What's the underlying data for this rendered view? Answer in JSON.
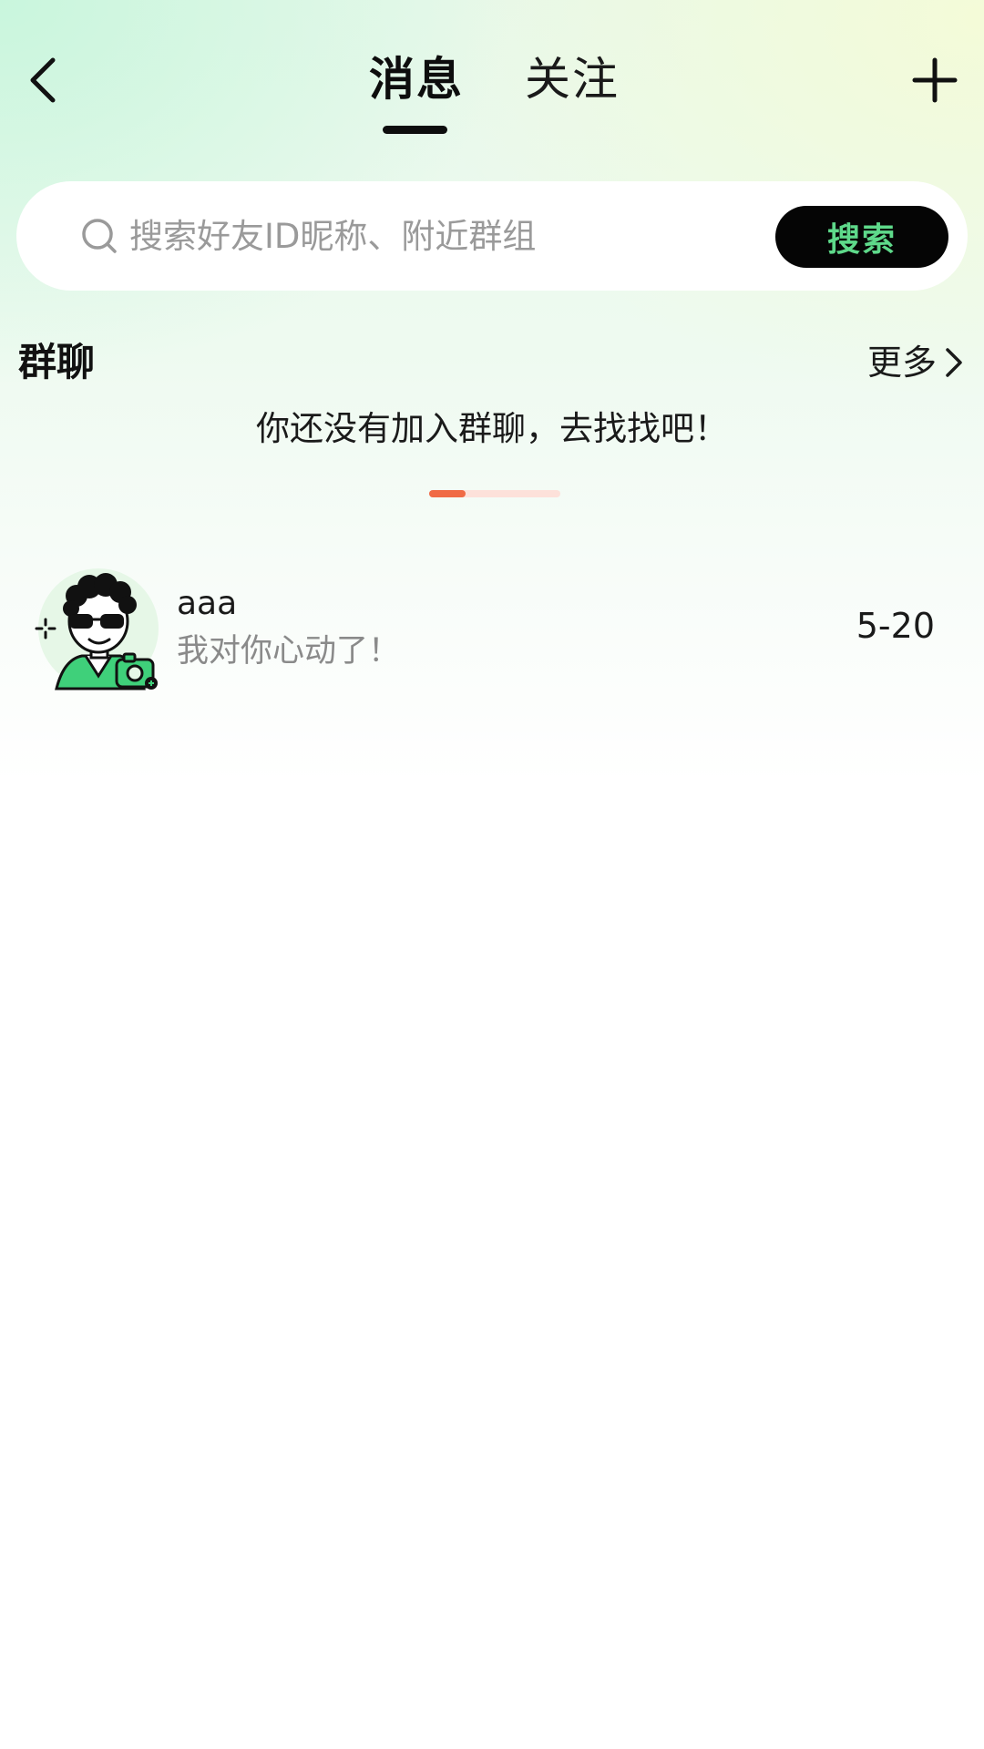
{
  "header": {
    "tabs": [
      {
        "label": "消息",
        "active": true
      },
      {
        "label": "关注",
        "active": false
      }
    ],
    "back_icon": "chevron-left-icon",
    "add_icon": "plus-icon"
  },
  "search": {
    "placeholder": "搜索好友ID昵称、附近群组",
    "value": "",
    "button_label": "搜索",
    "icon": "search-icon"
  },
  "group_chat": {
    "title": "群聊",
    "more_label": "更多",
    "empty_text": "你还没有加入群聊，去找找吧！",
    "page_indicator": {
      "progress": 0.28
    }
  },
  "messages": [
    {
      "name": "aaa",
      "preview": "我对你心动了！",
      "time": "5-20",
      "avatar": "avatar-cartoon-sunglasses"
    }
  ],
  "colors": {
    "accent_green": "#5ed98a",
    "indicator_active": "#f06a45",
    "indicator_track": "#fde1da"
  }
}
